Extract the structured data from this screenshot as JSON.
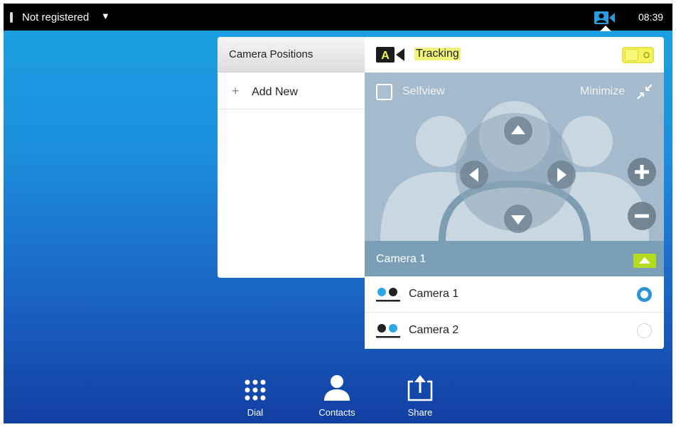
{
  "topbar": {
    "registration": "Not registered",
    "registration_caret": "▼",
    "status_icon": "camera-person-icon",
    "time": "08:39"
  },
  "positions_panel": {
    "title": "Camera Positions",
    "add_plus": "+",
    "add_label": "Add New"
  },
  "control_panel": {
    "tracking_badge": "A",
    "tracking_label": "Tracking",
    "tracking_on": true,
    "selfview_label": "Selfview",
    "minimize_label": "Minimize",
    "selected_camera": "Camera 1",
    "cameras": [
      {
        "label": "Camera 1",
        "icon": "dual-camera-left-active-icon",
        "selected": true
      },
      {
        "label": "Camera 2",
        "icon": "dual-camera-right-active-icon",
        "selected": false
      }
    ]
  },
  "dock": [
    {
      "label": "Dial",
      "icon": "dial-pad-icon"
    },
    {
      "label": "Contacts",
      "icon": "person-icon"
    },
    {
      "label": "Share",
      "icon": "share-icon"
    }
  ],
  "colors": {
    "accent_blue": "#2b93d6",
    "highlight_yellow": "#f5f35a",
    "toggle_green": "#b4dc1e",
    "panel_slate": "#7a9fb6"
  }
}
